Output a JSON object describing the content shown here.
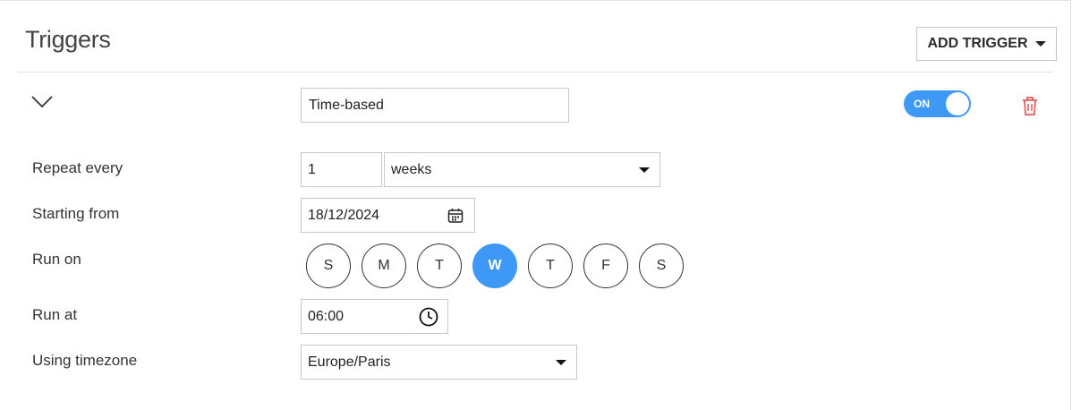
{
  "header": {
    "title": "Triggers",
    "add_trigger_label": "ADD TRIGGER"
  },
  "trigger": {
    "name": "Time-based",
    "enabled_label": "ON",
    "enabled": true
  },
  "form": {
    "repeat_label": "Repeat every",
    "repeat_value": "1",
    "repeat_unit": "weeks",
    "start_label": "Starting from",
    "start_date": "18/12/2024",
    "run_on_label": "Run on",
    "days": [
      {
        "letter": "S",
        "selected": false
      },
      {
        "letter": "M",
        "selected": false
      },
      {
        "letter": "T",
        "selected": false
      },
      {
        "letter": "W",
        "selected": true
      },
      {
        "letter": "T",
        "selected": false
      },
      {
        "letter": "F",
        "selected": false
      },
      {
        "letter": "S",
        "selected": false
      }
    ],
    "run_at_label": "Run at",
    "run_at_time": "06:00",
    "timezone_label": "Using timezone",
    "timezone_value": "Europe/Paris"
  },
  "colors": {
    "accent": "#3d99f5",
    "delete": "#e05a5a"
  },
  "icons": [
    "chevron-down-icon",
    "caret-down-icon",
    "trash-icon",
    "calendar-icon",
    "clock-icon"
  ]
}
